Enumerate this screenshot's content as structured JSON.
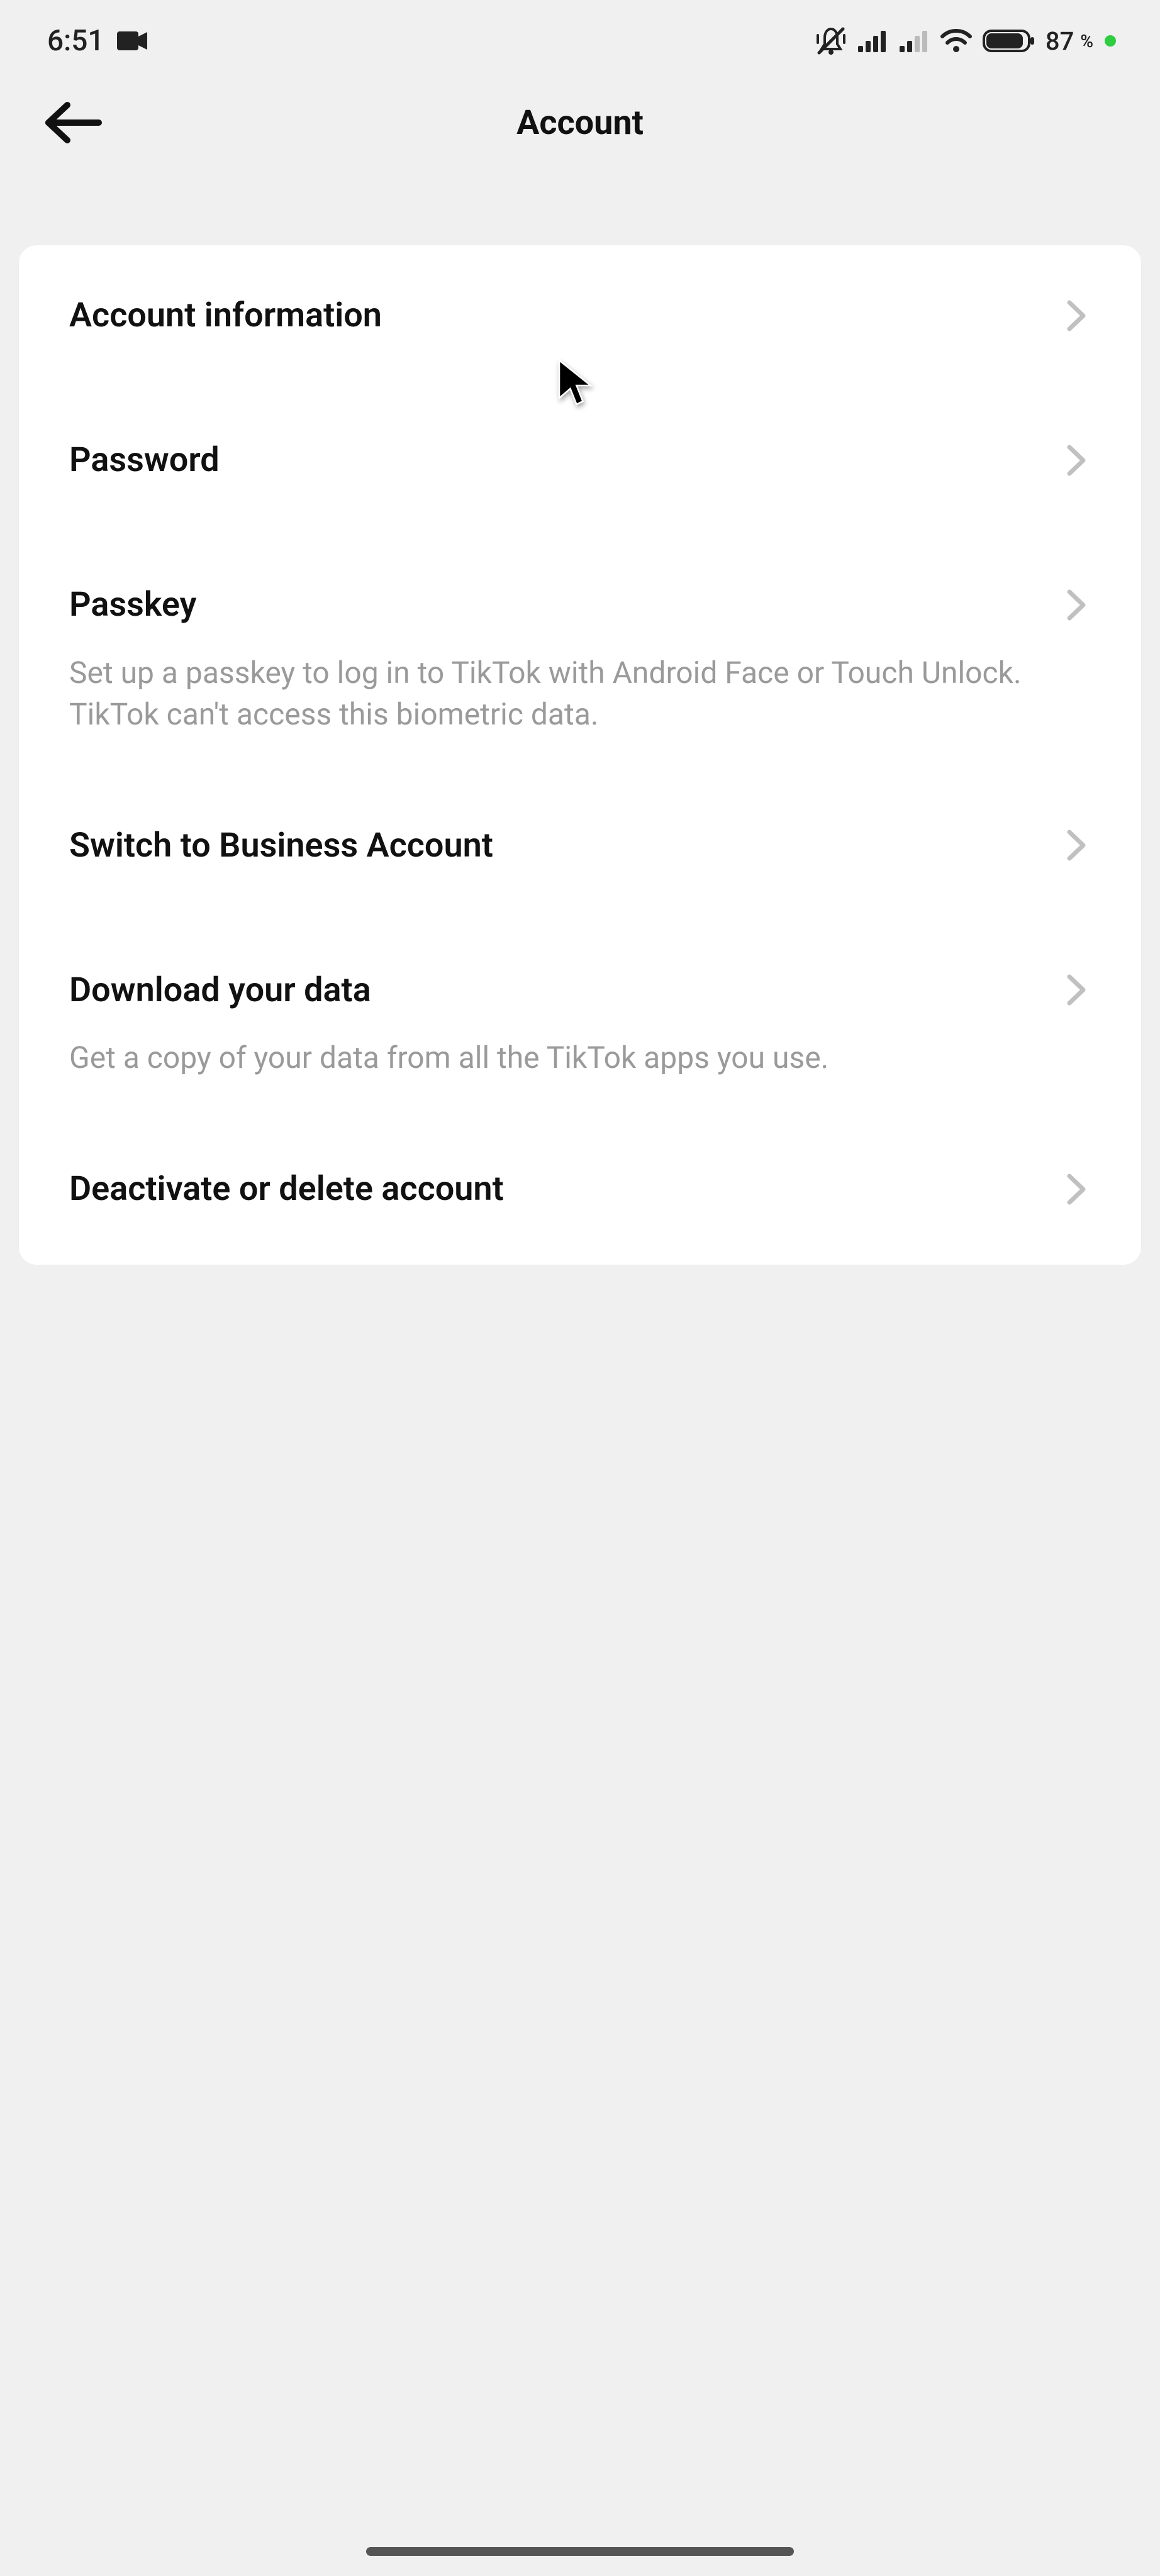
{
  "status": {
    "time": "6:51",
    "battery_text": "87",
    "battery_pct": "%"
  },
  "header": {
    "title": "Account"
  },
  "items": [
    {
      "label": "Account information",
      "sub": null
    },
    {
      "label": "Password",
      "sub": null
    },
    {
      "label": "Passkey",
      "sub": "Set up a passkey to log in to TikTok with Android Face or Touch Unlock. TikTok can't access this biometric data."
    },
    {
      "label": "Switch to Business Account",
      "sub": null
    },
    {
      "label": "Download your data",
      "sub": "Get a copy of your data from all the TikTok apps you use."
    },
    {
      "label": "Deactivate or delete account",
      "sub": null
    }
  ]
}
